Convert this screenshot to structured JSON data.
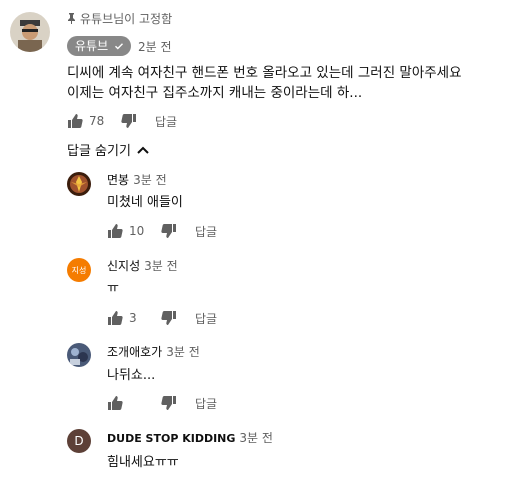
{
  "top_comment": {
    "pinned_label": "유튜브님이 고정함",
    "author": "유튜브",
    "time": "2분 전",
    "text_lines": [
      "디씨에 계속 여자친구 핸드폰 번호 올라오고 있는데 그러진 말아주세요",
      "이제는 여자친구 집주소까지 캐내는 중이라는데 하..."
    ],
    "likes": "78",
    "reply_label": "답글"
  },
  "hide_replies_label": "답글 숨기기",
  "replies": [
    {
      "author": "면봉",
      "time": "3분 전",
      "text": "미쳤네 애들이",
      "likes": "10",
      "reply_label": "답글",
      "avatar_text": ""
    },
    {
      "author": "신지성",
      "time": "3분 전",
      "text": "ㅠ",
      "likes": "3",
      "reply_label": "답글",
      "avatar_text": "지성"
    },
    {
      "author": "조개애호가",
      "time": "3분 전",
      "text": "나뒤쇼...",
      "likes": "",
      "reply_label": "답글",
      "avatar_text": ""
    },
    {
      "author": "DUDE STOP KIDDING",
      "time": "3분 전",
      "text": "힘내세요ㅠㅠ",
      "likes": "",
      "reply_label": "",
      "avatar_text": "D"
    }
  ],
  "colors": {
    "badge_bg": "#888888",
    "muted_text": "#606060",
    "sinjiseong_avatar": "#f57c00",
    "dude_avatar": "#5d4037"
  }
}
